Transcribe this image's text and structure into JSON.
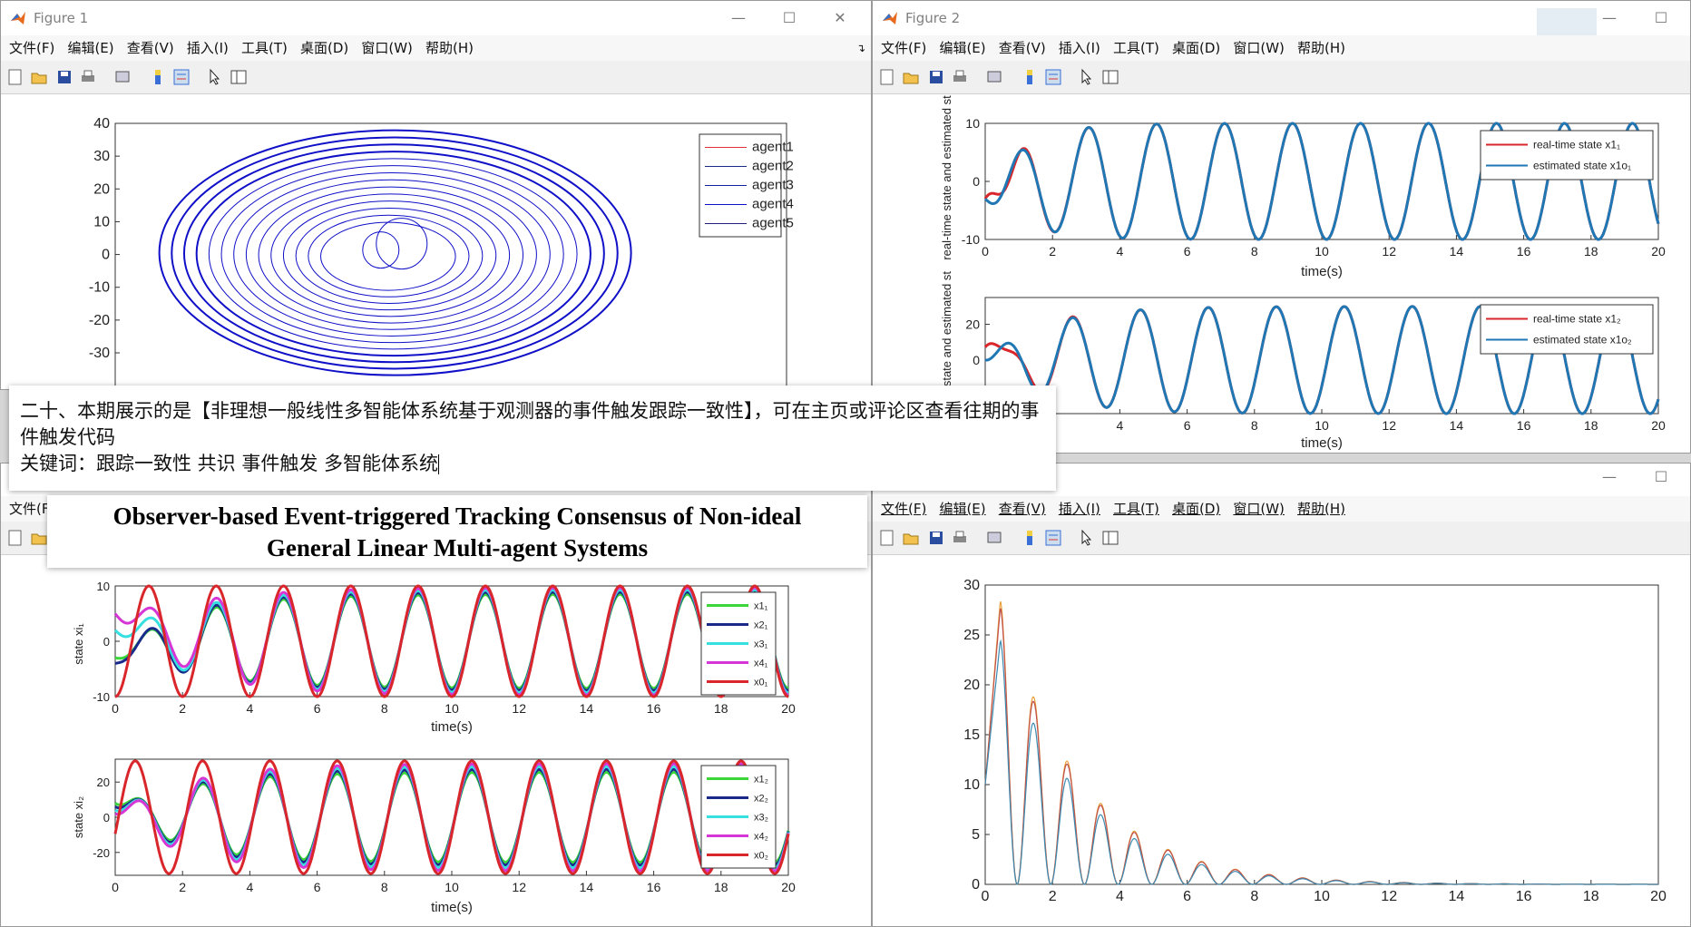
{
  "windows": {
    "fig1": {
      "title": "Figure 1"
    },
    "fig2": {
      "title": "Figure 2"
    },
    "fig3": {
      "title": ""
    },
    "fig4": {
      "title": ""
    }
  },
  "menu_labels": [
    "文件(F)",
    "编辑(E)",
    "查看(V)",
    "插入(I)",
    "工具(T)",
    "桌面(D)",
    "窗口(W)",
    "帮助(H)"
  ],
  "fig3_menu_visible": [
    "文件(F"
  ],
  "fig4_menu": [
    "文件(F)",
    "编辑(E)",
    "查看(V)",
    "插入(I)",
    "工具(T)",
    "桌面(D)",
    "窗口(W)",
    "帮助(H)"
  ],
  "overlay_note": {
    "line1": "二十、本期展示的是【非理想一般线性多智能体系统基于观测器的事件触发跟踪一致性】，可在主页或评论区查看往期的事件触发代码",
    "line2": "关键词：跟踪一致性  共识  事件触发  多智能体系统"
  },
  "overlay_title": {
    "line1": "Observer-based Event-triggered Tracking Consensus of Non-ideal",
    "line2": "General Linear Multi-agent Systems"
  },
  "colors": {
    "blue_agent": "#1010c8",
    "red": "#d9262b",
    "steel": "#1f77b4",
    "green": "#3ad63a",
    "navy": "#1a2a8a",
    "cyan": "#36e0e0",
    "magenta": "#d636d6"
  },
  "chart_data": [
    {
      "type": "line",
      "id": "fig1-phase",
      "x_ticks": [],
      "y_ticks": [
        "40",
        "30",
        "20",
        "10",
        "0",
        "-10",
        "-20",
        "-30"
      ],
      "ylim": [
        -30,
        40
      ],
      "legend": [
        "agent1",
        "agent2",
        "agent3",
        "agent4",
        "agent5"
      ],
      "legend_position": "top-right"
    },
    {
      "type": "line",
      "id": "fig2-top",
      "xlabel": "time(s)",
      "ylabel": "real-time state and estimated st",
      "x_ticks": [
        "0",
        "2",
        "4",
        "6",
        "8",
        "10",
        "12",
        "14",
        "16",
        "18",
        "20"
      ],
      "y_ticks": [
        "10",
        "0",
        "-10"
      ],
      "xlim": [
        0,
        20
      ],
      "ylim": [
        -10,
        10
      ],
      "series": [
        {
          "name": "real-time state x1₁"
        },
        {
          "name": "estimated state x1o₁"
        }
      ],
      "legend_position": "top-right"
    },
    {
      "type": "line",
      "id": "fig2-bottom",
      "xlabel": "time(s)",
      "ylabel": "e state and estimated st",
      "x_ticks": [
        "4",
        "6",
        "8",
        "10",
        "12",
        "14",
        "16",
        "18",
        "20"
      ],
      "y_ticks": [
        "20",
        "0"
      ],
      "xlim": [
        0,
        20
      ],
      "ylim": [
        -30,
        30
      ],
      "series": [
        {
          "name": "real-time state x1₂"
        },
        {
          "name": "estimated state x1o₂"
        }
      ],
      "legend_position": "top-right"
    },
    {
      "type": "line",
      "id": "fig3-top",
      "xlabel": "time(s)",
      "ylabel": "state xi₁",
      "x_ticks": [
        "0",
        "2",
        "4",
        "6",
        "8",
        "10",
        "12",
        "14",
        "16",
        "18",
        "20"
      ],
      "y_ticks": [
        "10",
        "0",
        "-10"
      ],
      "xlim": [
        0,
        20
      ],
      "ylim": [
        -10,
        10
      ],
      "series": [
        {
          "name": "x1₁"
        },
        {
          "name": "x2₁"
        },
        {
          "name": "x3₁"
        },
        {
          "name": "x4₁"
        },
        {
          "name": "x0₁"
        }
      ],
      "legend_position": "top-right"
    },
    {
      "type": "line",
      "id": "fig3-bottom",
      "xlabel": "time(s)",
      "ylabel": "state xi₂",
      "x_ticks": [
        "0",
        "2",
        "4",
        "6",
        "8",
        "10",
        "12",
        "14",
        "16",
        "18",
        "20"
      ],
      "y_ticks": [
        "20",
        "0",
        "-20"
      ],
      "xlim": [
        0,
        20
      ],
      "ylim": [
        -33,
        33
      ],
      "series": [
        {
          "name": "x1₂"
        },
        {
          "name": "x2₂"
        },
        {
          "name": "x3₂"
        },
        {
          "name": "x4₂"
        },
        {
          "name": "x0₂"
        }
      ],
      "legend_position": "top-right"
    },
    {
      "type": "line",
      "id": "fig4-decay",
      "x_ticks": [
        "0",
        "2",
        "4",
        "6",
        "8",
        "10",
        "12",
        "14",
        "16",
        "18",
        "20"
      ],
      "y_ticks": [
        "30",
        "25",
        "20",
        "15",
        "10",
        "5",
        "0"
      ],
      "xlim": [
        0,
        20
      ],
      "ylim": [
        0,
        30
      ],
      "peaks": [
        28.5,
        27.8,
        24.5
      ]
    }
  ]
}
